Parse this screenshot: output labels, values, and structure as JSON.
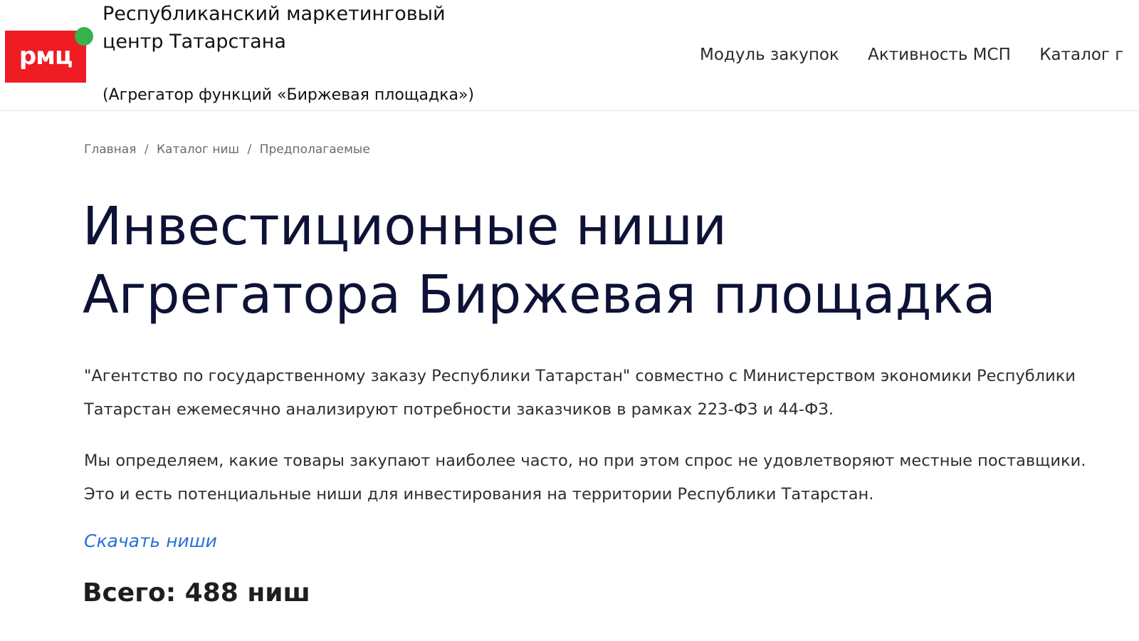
{
  "header": {
    "logo_text": "рмц",
    "org_name": "Республиканский маркетинговый центр Татарстана",
    "org_subtitle": "(Агрегатор функций «Биржевая площадка»)",
    "nav": [
      {
        "label": "Модуль закупок"
      },
      {
        "label": "Активность МСП"
      },
      {
        "label": "Каталог г"
      }
    ],
    "colors": {
      "logo_bg": "#ef1c24",
      "logo_dot": "#37b24d"
    }
  },
  "breadcrumb": {
    "items": [
      "Главная",
      "Каталог ниш",
      "Предполагаемые"
    ],
    "separator": "/"
  },
  "main": {
    "title_line1": "Инвестиционные ниши",
    "title_line2": "Агрегатора Биржевая площадка",
    "paragraph1": "\"Агентство по государственному заказу Республики Татарстан\" совместно с Министерством экономики Республики Татарстан ежемесячно анализируют потребности заказчиков в рамках 223-ФЗ и 44-ФЗ.",
    "paragraph2": "Мы определяем, какие товары закупают наиболее часто, но при этом спрос не удовлетворяют местные поставщики. Это и есть потенциальные ниши для инвестирования на территории Республики Татарстан.",
    "download_link": "Скачать ниши",
    "total": "Всего: 488 ниш",
    "colors": {
      "title": "#0d1236",
      "link": "#2a6fd6"
    }
  }
}
